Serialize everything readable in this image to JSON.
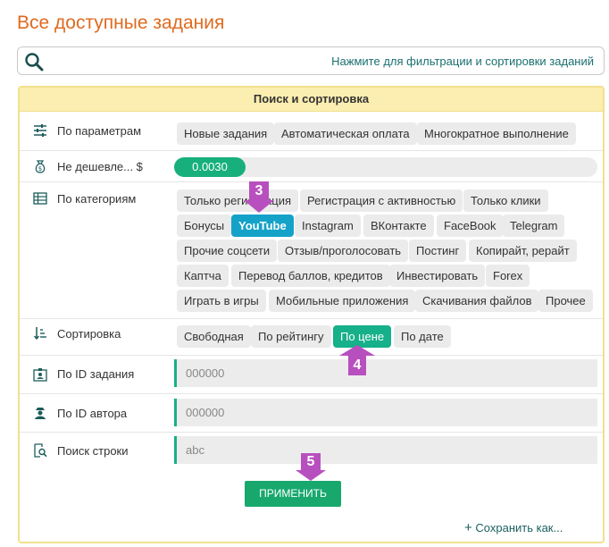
{
  "page": {
    "title": "Все доступные задания"
  },
  "filter_bar": {
    "hint": "Нажмите для фильтрации и сортировки заданий",
    "icon": "search-icon"
  },
  "panel": {
    "title": "Поиск и сортировка",
    "params": {
      "label": "По параметрам",
      "chips": [
        "Новые задания",
        "Автоматическая оплата",
        "Многократное выполнение"
      ]
    },
    "price": {
      "label": "Не дешевле... $",
      "value": "0.0030"
    },
    "categories": {
      "label": "По категориям",
      "chips": [
        "Только регистрация",
        "Регистрация с активностью",
        "Только клики",
        "Бонусы",
        "YouTube",
        "Instagram",
        "ВКонтакте",
        "FaceBook",
        "Telegram",
        "Прочие соцсети",
        "Отзыв/проголосовать",
        "Постинг",
        "Копирайт, рерайт",
        "Каптча",
        "Перевод баллов, кредитов",
        "Инвестировать",
        "Forex",
        "Играть в игры",
        "Мобильные приложения",
        "Скачивания файлов",
        "Прочее"
      ],
      "selected": "YouTube"
    },
    "sort": {
      "label": "Сортировка",
      "chips": [
        "Свободная",
        "По рейтингу",
        "По цене",
        "По дате"
      ],
      "selected": "По цене"
    },
    "task_id": {
      "label": "По ID задания",
      "placeholder": "000000"
    },
    "author_id": {
      "label": "По ID автора",
      "placeholder": "000000"
    },
    "search": {
      "label": "Поиск строки",
      "placeholder": "abc"
    },
    "apply_label": "ПРИМЕНИТЬ",
    "save_label": "Сохранить как..."
  },
  "markers": [
    "3",
    "4",
    "5"
  ],
  "colors": {
    "title": "#e06a1f",
    "header_bg": "#fbeeb0",
    "blue_active": "#15a2c8",
    "green_active": "#16b08a",
    "marker": "#b84fbf"
  }
}
